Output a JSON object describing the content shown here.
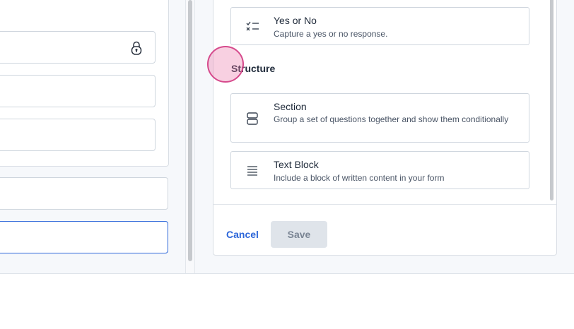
{
  "colors": {
    "accent": "#2c66d9",
    "save_disabled_bg": "#dfe4ea",
    "cursor_highlight": "#d64a8c"
  },
  "options_group_1": [
    {
      "title": "Yes or No",
      "description": "Capture a yes or no response.",
      "icon": "checklist-icon"
    }
  ],
  "structure": {
    "heading": "Structure",
    "items": [
      {
        "title": "Section",
        "description": "Group a set of questions together and show them conditionally",
        "icon": "section-icon"
      },
      {
        "title": "Text Block",
        "description": "Include a block of written content in your form",
        "icon": "text-block-icon"
      }
    ]
  },
  "footer": {
    "cancel_label": "Cancel",
    "save_label": "Save"
  }
}
